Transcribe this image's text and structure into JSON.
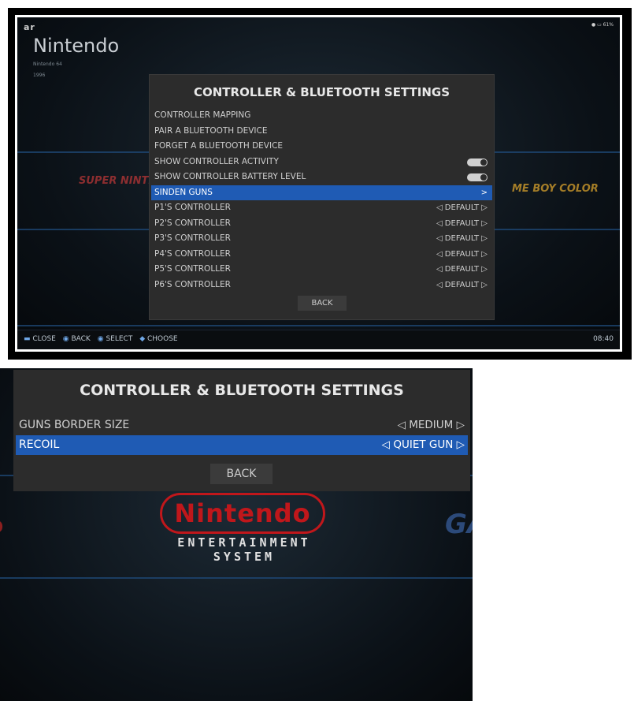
{
  "top_screen": {
    "brand_logo": "ar",
    "status": "● ▭ 61%",
    "system": {
      "name": "Nintendo",
      "subtitle": "Nintendo 64",
      "year": "1996"
    },
    "ghost_left_logo": "SUPER NINTENDO",
    "ghost_right_logo": "ME BOY COLOR",
    "menu": {
      "title": "CONTROLLER & BLUETOOTH SETTINGS",
      "items": [
        {
          "label": "CONTROLLER MAPPING"
        },
        {
          "label": "PAIR A BLUETOOTH DEVICE"
        },
        {
          "label": "FORGET A BLUETOOTH DEVICE"
        },
        {
          "label": "SHOW CONTROLLER ACTIVITY",
          "toggle": true
        },
        {
          "label": "SHOW CONTROLLER BATTERY LEVEL",
          "toggle": true
        },
        {
          "label": "SINDEN GUNS",
          "value": ">",
          "selected": true
        },
        {
          "label": "P1'S CONTROLLER",
          "value": "◁ DEFAULT ▷"
        },
        {
          "label": "P2'S CONTROLLER",
          "value": "◁ DEFAULT ▷"
        },
        {
          "label": "P3'S CONTROLLER",
          "value": "◁ DEFAULT ▷"
        },
        {
          "label": "P4'S CONTROLLER",
          "value": "◁ DEFAULT ▷"
        },
        {
          "label": "P5'S CONTROLLER",
          "value": "◁ DEFAULT ▷"
        },
        {
          "label": "P6'S CONTROLLER",
          "value": "◁ DEFAULT ▷"
        }
      ],
      "back_label": "BACK"
    },
    "footer": {
      "hints": [
        {
          "icon": "▬",
          "label": "CLOSE"
        },
        {
          "icon": "◉",
          "label": "BACK"
        },
        {
          "icon": "◉",
          "label": "SELECT"
        },
        {
          "icon": "◆",
          "label": "CHOOSE"
        }
      ],
      "clock": "08:40"
    }
  },
  "bottom_screen": {
    "menu": {
      "title": "CONTROLLER & BLUETOOTH SETTINGS",
      "items": [
        {
          "label": "GUNS BORDER SIZE",
          "value": "◁ MEDIUM ▷"
        },
        {
          "label": "RECOIL",
          "value": "◁ QUIET GUN ▷",
          "selected": true
        }
      ],
      "back_label": "BACK"
    },
    "nes_logo": {
      "wordmark": "Nintendo",
      "line1": "ENTERTAINMENT",
      "line2": "SYSTEM"
    },
    "ghost_left": "D",
    "ghost_right": "GA"
  },
  "colors": {
    "accent": "#1f5bb4",
    "panel": "#2c2c2c",
    "nes_red": "#c0171b"
  }
}
